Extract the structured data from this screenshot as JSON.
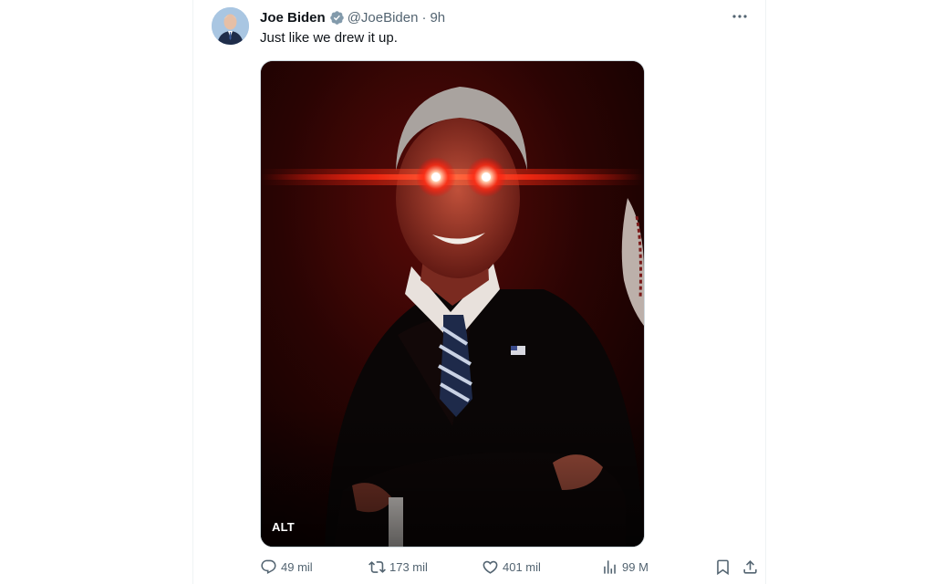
{
  "tweet": {
    "display_name": "Joe Biden",
    "handle": "@JoeBiden",
    "separator": "·",
    "time": "9h",
    "text": "Just like we drew it up.",
    "media": {
      "alt_badge": "ALT"
    },
    "actions": {
      "replies": "49 mil",
      "reposts": "173 mil",
      "likes": "401 mil",
      "views": "99 M"
    }
  },
  "icons": {
    "verified": "verified-badge-icon",
    "more": "more-icon",
    "reply": "reply-icon",
    "repost": "repost-icon",
    "like": "like-icon",
    "views": "views-icon",
    "bookmark": "bookmark-icon",
    "share": "share-icon"
  },
  "colors": {
    "text_primary": "#0f1419",
    "text_secondary": "#536471",
    "verified": "#829aab",
    "eye_glow": "#ff2a1a"
  }
}
